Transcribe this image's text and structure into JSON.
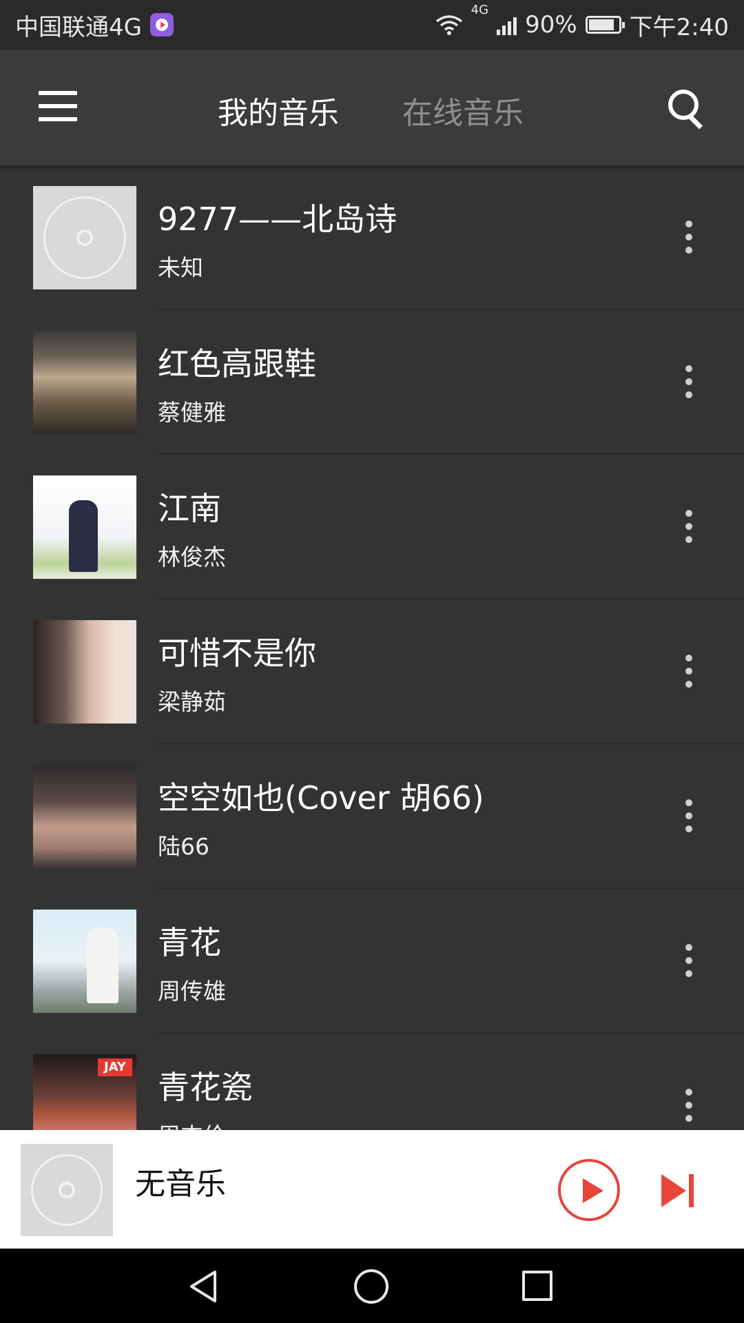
{
  "status_bar": {
    "carrier": "中国联通4G",
    "network_type": "4G",
    "battery": "90%",
    "battery_level": 0.9,
    "time": "下午2:40"
  },
  "header": {
    "tabs": [
      {
        "label": "我的音乐",
        "active": true
      },
      {
        "label": "在线音乐",
        "active": false
      }
    ],
    "icons": {
      "menu": "hamburger-menu-icon",
      "search": "search-icon"
    }
  },
  "songs": [
    {
      "title": "9277——北岛诗",
      "artist": "未知",
      "cover": "default-disc"
    },
    {
      "title": "红色高跟鞋",
      "artist": "蔡健雅",
      "cover": "album-art"
    },
    {
      "title": "江南",
      "artist": "林俊杰",
      "cover": "album-art"
    },
    {
      "title": "可惜不是你",
      "artist": "梁静茹",
      "cover": "album-art"
    },
    {
      "title": "空空如也(Cover 胡66)",
      "artist": "陆66",
      "cover": "album-art"
    },
    {
      "title": "青花",
      "artist": "周传雄",
      "cover": "album-art"
    },
    {
      "title": "青花瓷",
      "artist": "周杰伦",
      "cover": "album-art",
      "album_badge": "JAY"
    }
  ],
  "player": {
    "title": "无音乐",
    "accent_color": "#e8443a"
  },
  "colors": {
    "background": "#333333",
    "header": "#3b3b3b",
    "player_background": "#ffffff"
  }
}
